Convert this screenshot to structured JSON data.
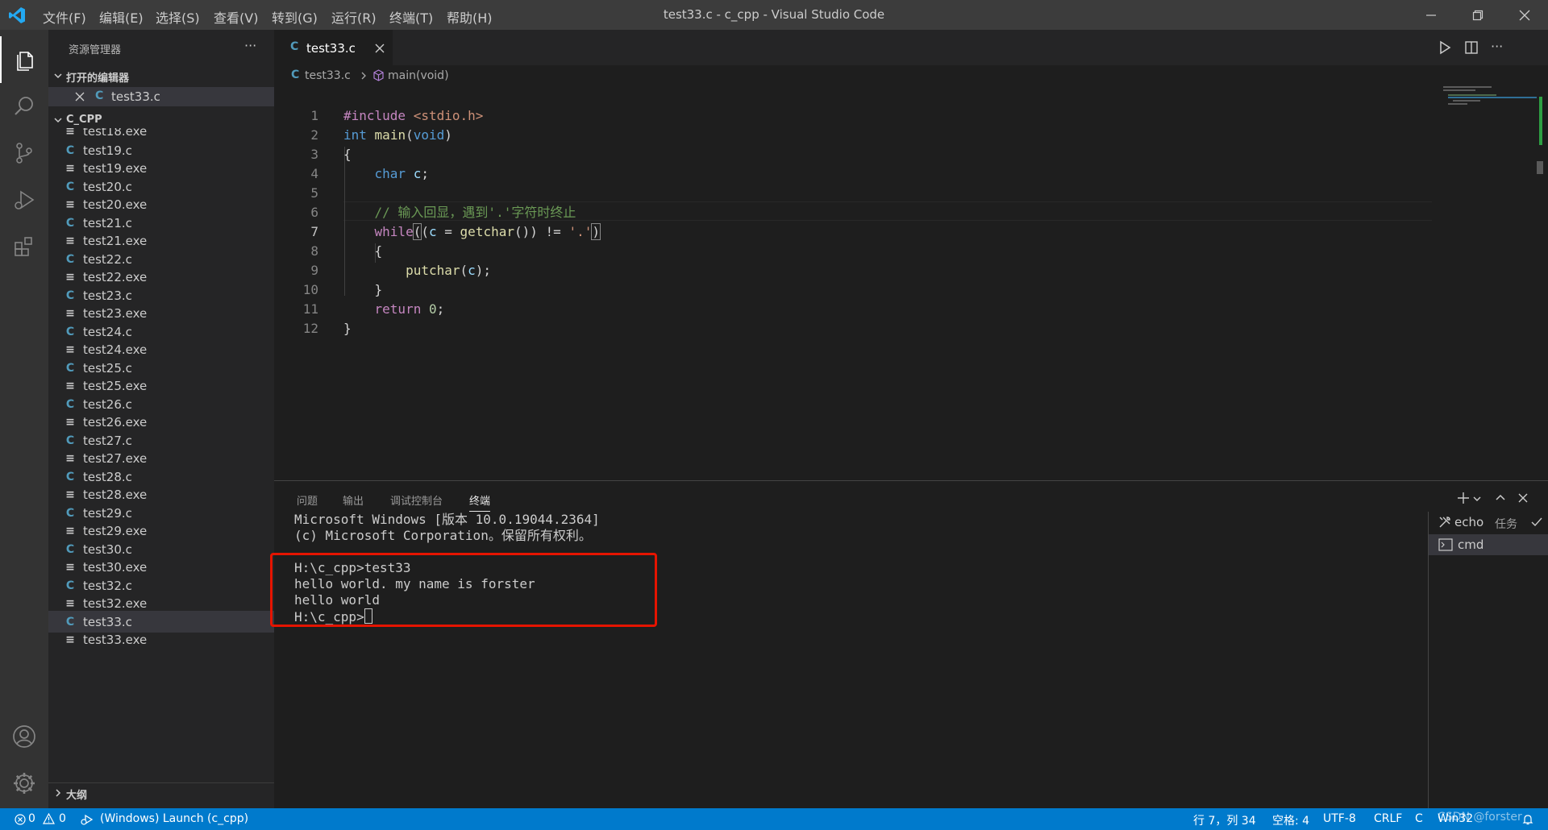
{
  "titlebar": {
    "window_title": "test33.c - c_cpp - Visual Studio Code",
    "menu": [
      "文件(F)",
      "编辑(E)",
      "选择(S)",
      "查看(V)",
      "转到(G)",
      "运行(R)",
      "终端(T)",
      "帮助(H)"
    ]
  },
  "sidebar": {
    "title": "资源管理器",
    "more": "···",
    "open_editors": {
      "label": "打开的编辑器",
      "file": "test33.c"
    },
    "folder": {
      "label": "C_CPP",
      "partial_file": "test18.exe"
    },
    "files": [
      {
        "name": "test19.c",
        "type": "c"
      },
      {
        "name": "test19.exe",
        "type": "exe"
      },
      {
        "name": "test20.c",
        "type": "c"
      },
      {
        "name": "test20.exe",
        "type": "exe"
      },
      {
        "name": "test21.c",
        "type": "c"
      },
      {
        "name": "test21.exe",
        "type": "exe"
      },
      {
        "name": "test22.c",
        "type": "c"
      },
      {
        "name": "test22.exe",
        "type": "exe"
      },
      {
        "name": "test23.c",
        "type": "c"
      },
      {
        "name": "test23.exe",
        "type": "exe"
      },
      {
        "name": "test24.c",
        "type": "c"
      },
      {
        "name": "test24.exe",
        "type": "exe"
      },
      {
        "name": "test25.c",
        "type": "c"
      },
      {
        "name": "test25.exe",
        "type": "exe"
      },
      {
        "name": "test26.c",
        "type": "c"
      },
      {
        "name": "test26.exe",
        "type": "exe"
      },
      {
        "name": "test27.c",
        "type": "c"
      },
      {
        "name": "test27.exe",
        "type": "exe"
      },
      {
        "name": "test28.c",
        "type": "c"
      },
      {
        "name": "test28.exe",
        "type": "exe"
      },
      {
        "name": "test29.c",
        "type": "c"
      },
      {
        "name": "test29.exe",
        "type": "exe"
      },
      {
        "name": "test30.c",
        "type": "c"
      },
      {
        "name": "test30.exe",
        "type": "exe"
      },
      {
        "name": "test32.c",
        "type": "c"
      },
      {
        "name": "test32.exe",
        "type": "exe"
      },
      {
        "name": "test33.c",
        "type": "c",
        "selected": true
      },
      {
        "name": "test33.exe",
        "type": "exe"
      }
    ],
    "outline_label": "大纲"
  },
  "editor": {
    "tab_label": "test33.c",
    "breadcrumb_file": "test33.c",
    "breadcrumb_symbol": "main(void)",
    "lines": [
      "#include <stdio.h>",
      "int main(void)",
      "{",
      "    char c;",
      "",
      "    // 输入回显，遇到'.'字符时终止",
      "    while((c = getchar()) != '.')",
      "    {",
      "        putchar(c);",
      "    }",
      "    return 0;",
      "}"
    ],
    "current_line": 7
  },
  "panel": {
    "tabs": [
      "问题",
      "输出",
      "调试控制台",
      "终端"
    ],
    "active_tab": "终端",
    "terminal_lines": [
      "Microsoft Windows [版本 10.0.19044.2364]",
      "(c) Microsoft Corporation。保留所有权利。",
      "",
      "H:\\c_cpp>test33",
      "hello world. my name is forster",
      "hello world",
      "H:\\c_cpp>"
    ],
    "terminals": [
      {
        "name": "echo",
        "suffix": "任务"
      },
      {
        "name": "cmd"
      }
    ],
    "highlight_color": "#e51400"
  },
  "statusbar": {
    "errors": "0",
    "warnings": "0",
    "launch": "(Windows) Launch (c_cpp)",
    "position": "行 7，列 34",
    "spaces": "空格: 4",
    "encoding": "UTF-8",
    "eol": "CRLF",
    "language": "C",
    "platform": "Win32",
    "watermark": "CSDN @forster"
  },
  "colors": {
    "accent": "#007acc",
    "c_icon": "#519aba"
  }
}
